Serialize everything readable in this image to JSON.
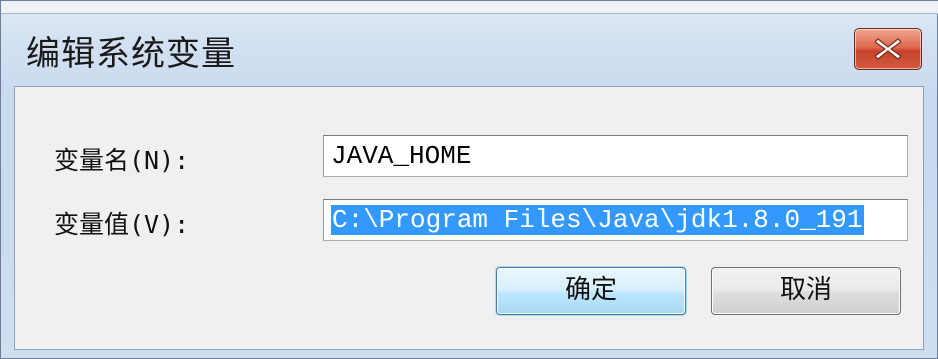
{
  "window": {
    "title": "编辑系统变量",
    "close_icon": "close-icon"
  },
  "form": {
    "name_label": "变量名(N):",
    "name_value": "JAVA_HOME",
    "value_label": "变量值(V):",
    "value_value": "C:\\Program Files\\Java\\jdk1.8.0_191",
    "value_selected": true
  },
  "buttons": {
    "ok_label": "确定",
    "cancel_label": "取消"
  },
  "colors": {
    "selection": "#3399ff",
    "close_button": "#c7432a",
    "ok_button_border": "#3c7fb1"
  }
}
